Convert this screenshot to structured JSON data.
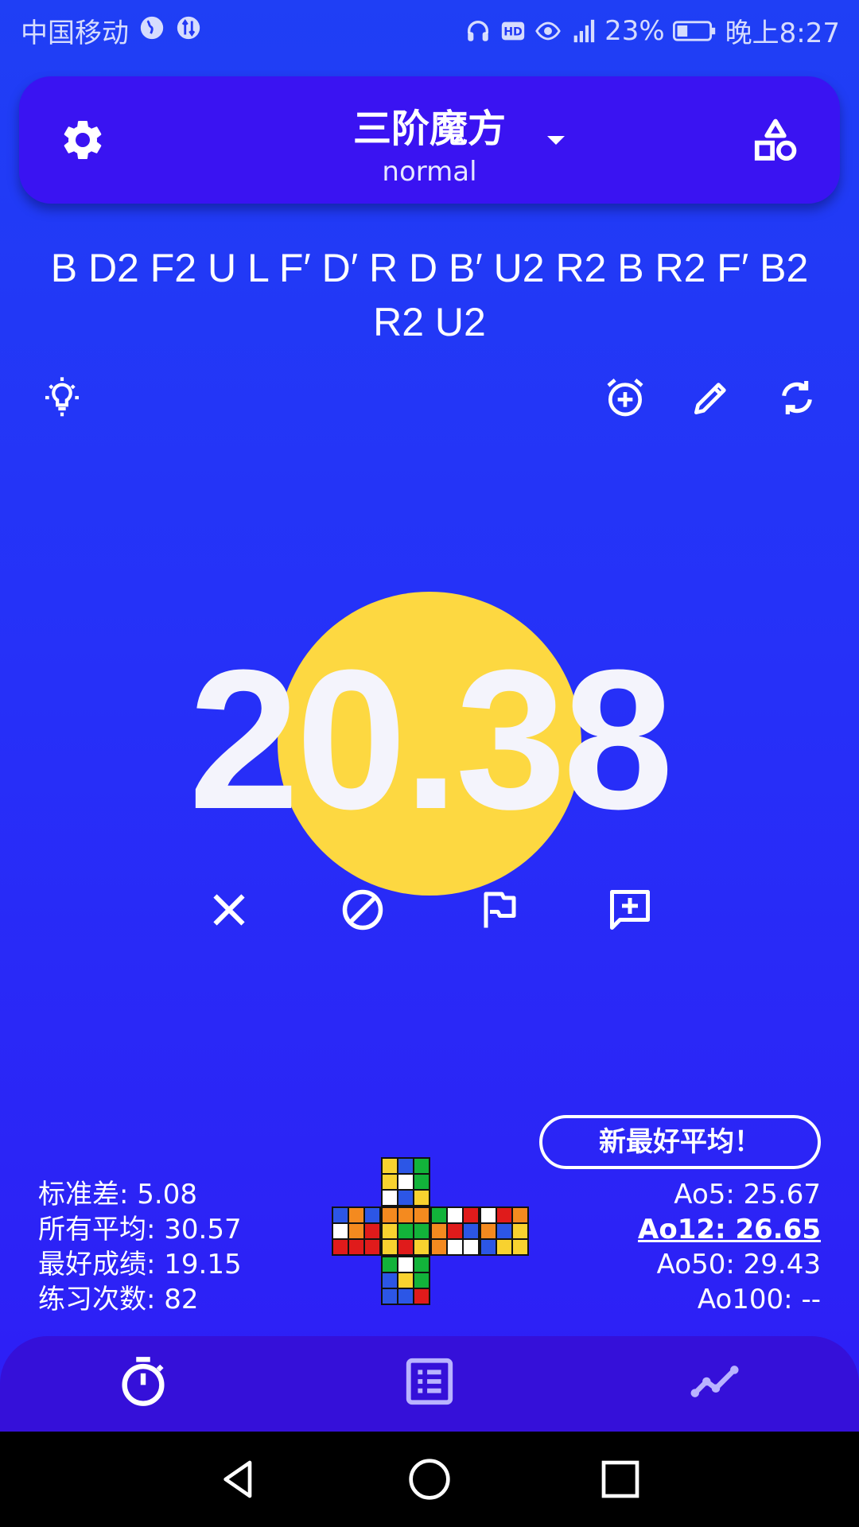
{
  "status_bar": {
    "carrier": "中国移动",
    "battery_percent": "23%",
    "time": "晚上8:27"
  },
  "header": {
    "puzzle_title": "三阶魔方",
    "category": "normal"
  },
  "scramble": "B D2 F2 U L F′ D′ R D B′ U2 R2 B R2 F′ B2 R2 U2",
  "timer": {
    "time": "20.38",
    "circle_color": "#fdd841"
  },
  "badge": {
    "label": "新最好平均！"
  },
  "stats_left": {
    "std_dev": "标准差: 5.08",
    "overall_avg": "所有平均: 30.57",
    "best": "最好成绩: 19.15",
    "count": "练习次数: 82"
  },
  "stats_right": {
    "ao5": "Ao5: 25.67",
    "ao12": "Ao12: 26.65",
    "ao50": "Ao50: 29.43",
    "ao100": "Ao100: --"
  },
  "cube_net": {
    "U": [
      "Y",
      "B",
      "G",
      "Y",
      "W",
      "G",
      "W",
      "B",
      "Y"
    ],
    "L": [
      "B",
      "O",
      "B",
      "W",
      "O",
      "R",
      "R",
      "R",
      "R"
    ],
    "F": [
      "O",
      "O",
      "O",
      "Y",
      "G",
      "G",
      "Y",
      "R",
      "Y"
    ],
    "R": [
      "G",
      "W",
      "R",
      "O",
      "R",
      "B",
      "O",
      "W",
      "W"
    ],
    "B": [
      "W",
      "R",
      "O",
      "O",
      "B",
      "Y",
      "B",
      "Y",
      "Y"
    ],
    "D": [
      "G",
      "W",
      "G",
      "B",
      "Y",
      "G",
      "B",
      "B",
      "R"
    ]
  },
  "colors": {
    "background_top": "#1f3ff5",
    "header_card": "#3a13f2",
    "accent_yellow": "#fdd841",
    "W": "#ffffff",
    "Y": "#f8d22f",
    "R": "#e01b1b",
    "O": "#f48a1f",
    "B": "#2c56e6",
    "G": "#12b33a"
  },
  "icons": {
    "settings": "gear-icon",
    "puzzle_select": "shapes-icon",
    "inspection": "lightbulb-icon",
    "add_time": "alarm-add-icon",
    "edit": "pencil-icon",
    "refresh": "refresh-icon",
    "delete": "close-icon",
    "dnf": "block-icon",
    "plus_two": "flag-icon",
    "comment": "comment-add-icon",
    "nav_timer": "stopwatch-icon",
    "nav_list": "list-icon",
    "nav_stats": "trend-icon"
  }
}
